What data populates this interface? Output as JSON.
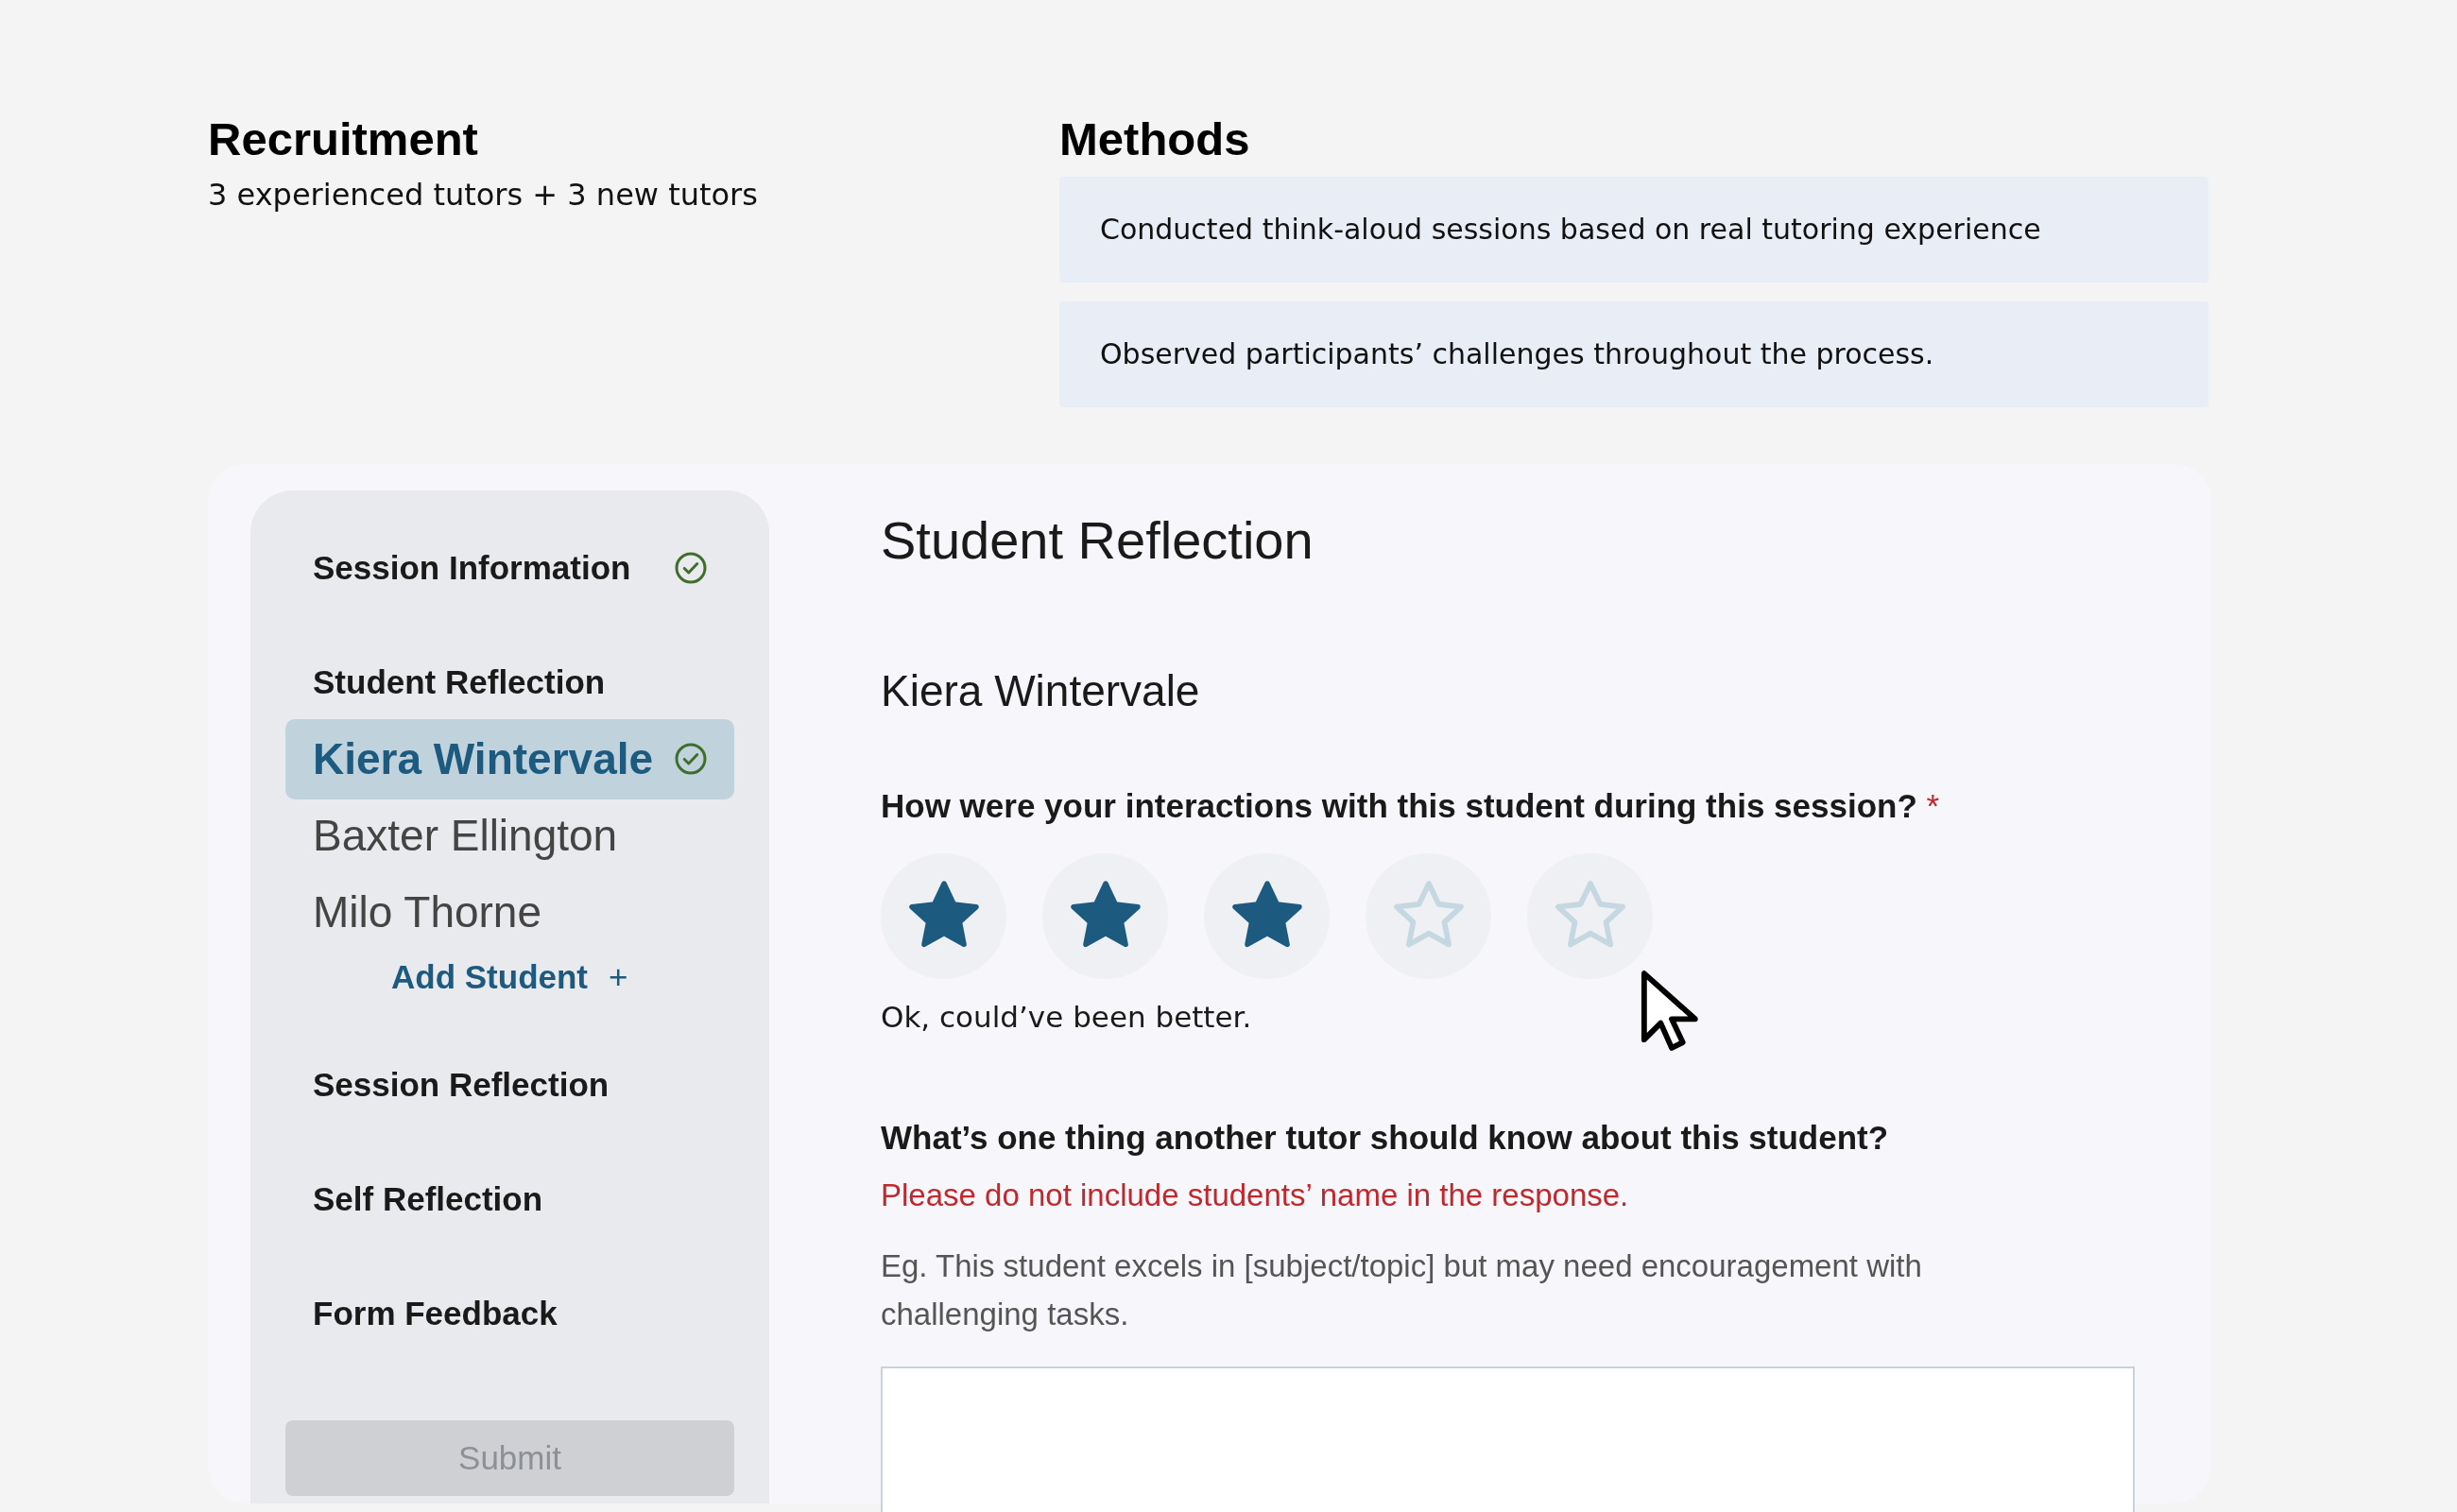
{
  "recruitment": {
    "heading": "Recruitment",
    "text": "3 experienced tutors + 3 new tutors"
  },
  "methods": {
    "heading": "Methods",
    "items": [
      "Conducted think-aloud sessions based on real tutoring experience",
      "Observed participants’ challenges throughout the process."
    ]
  },
  "sidebar": {
    "items": [
      {
        "kind": "section",
        "label": "Session Information",
        "completed": true,
        "selected": false
      },
      {
        "kind": "section",
        "label": "Student Reflection",
        "completed": false,
        "selected": false
      },
      {
        "kind": "student",
        "label": "Kiera Wintervale",
        "completed": true,
        "selected": true
      },
      {
        "kind": "student",
        "label": "Baxter Ellington",
        "completed": false,
        "selected": false
      },
      {
        "kind": "student",
        "label": "Milo Thorne",
        "completed": false,
        "selected": false
      },
      {
        "kind": "add",
        "label": "Add Student",
        "icon": "+"
      },
      {
        "kind": "section",
        "label": "Session Reflection",
        "completed": false,
        "selected": false
      },
      {
        "kind": "section",
        "label": "Self Reflection",
        "completed": false,
        "selected": false
      },
      {
        "kind": "section",
        "label": "Form Feedback",
        "completed": false,
        "selected": false
      }
    ],
    "submit": {
      "label": "Submit",
      "disabled": true
    }
  },
  "form": {
    "title": "Student Reflection",
    "student": "Kiera Wintervale",
    "rating": {
      "question": "How were your interactions with this student during this session?",
      "required_mark": "*",
      "stars": 3,
      "caption": "Ok, could’ve been better."
    },
    "note_question": {
      "question": "What’s one thing another tutor should know about this student?",
      "warning": "Please do not include students’ name in the response.",
      "hint": "Eg. This student excels in [subject/topic] but may need encouragement with challenging tasks."
    }
  }
}
